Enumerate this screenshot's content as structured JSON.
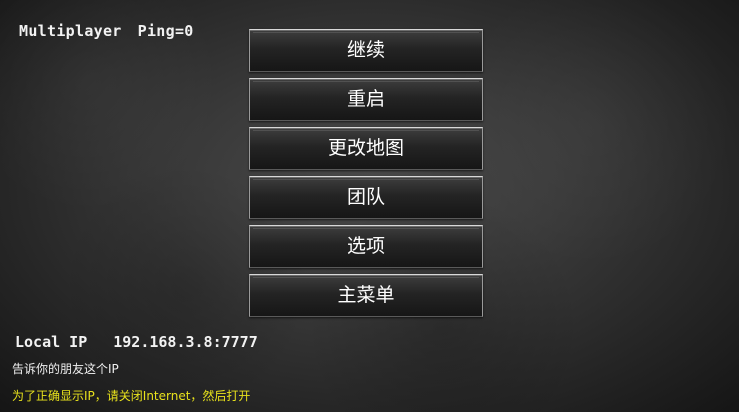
{
  "status": {
    "mode": "Multiplayer",
    "ping": "Ping=0"
  },
  "menu": {
    "items": [
      {
        "label": "继续"
      },
      {
        "label": "重启"
      },
      {
        "label": "更改地图"
      },
      {
        "label": "团队"
      },
      {
        "label": "选项"
      },
      {
        "label": "主菜单"
      }
    ]
  },
  "network": {
    "ip_label": "Local IP",
    "ip_value": "192.168.3.8:7777",
    "share_hint": "告诉你的朋友这个IP",
    "warning": "为了正确显示IP，请关闭Internet，然后打开"
  },
  "colors": {
    "warning_text": "#e8e21c",
    "text": "#ffffff"
  }
}
